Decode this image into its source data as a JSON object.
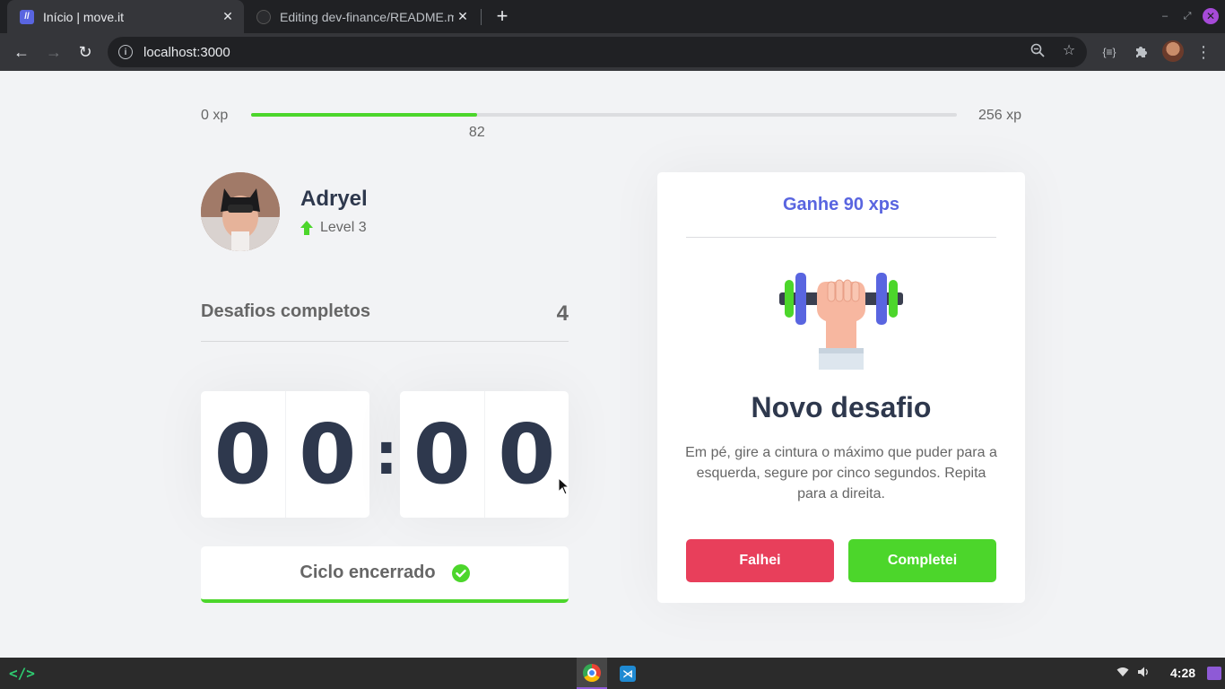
{
  "browser": {
    "tabs": [
      {
        "title": "Início | move.it",
        "active": true
      },
      {
        "title": "Editing dev-finance/README.md",
        "active": false
      }
    ],
    "url": "localhost:3000"
  },
  "xp_bar": {
    "min_label": "0 xp",
    "max_label": "256 xp",
    "current_label": "82",
    "progress_fraction": 0.32
  },
  "profile": {
    "name": "Adryel",
    "level": "Level 3"
  },
  "challenges": {
    "label": "Desafios completos",
    "count": "4"
  },
  "countdown": {
    "minute_digits": [
      "0",
      "0"
    ],
    "second_digits": [
      "0",
      "0"
    ],
    "separator": ":"
  },
  "cycle_button": {
    "label": "Ciclo encerrado"
  },
  "challenge_card": {
    "header": "Ganhe 90 xps",
    "title": "Novo desafio",
    "description": "Em pé, gire a cintura o máximo que puder para a esquerda, segure por cinco segundos. Repita para a direita.",
    "fail_label": "Falhei",
    "success_label": "Completei"
  },
  "taskbar": {
    "clock": "4:28"
  },
  "colors": {
    "primary_text": "#2e384d",
    "accent_blue": "#5965e0",
    "green": "#4cd62b",
    "red": "#e83f5b"
  }
}
